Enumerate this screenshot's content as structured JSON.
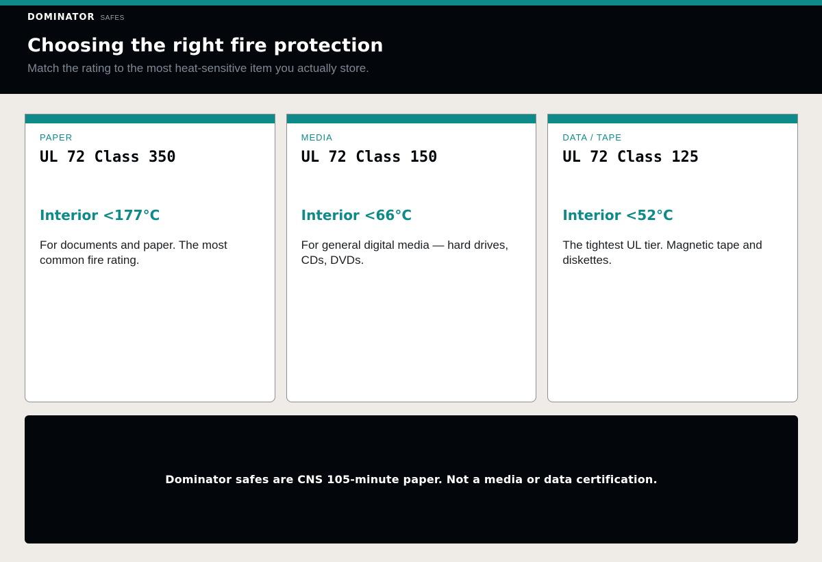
{
  "brand": {
    "name": "DOMINATOR",
    "sub": "SAFES"
  },
  "header": {
    "title": "Choosing the right fire protection",
    "subtitle": "Match the rating to the most heat-sensitive item you actually store."
  },
  "cards": [
    {
      "category": "PAPER",
      "rating": "UL 72 Class 350",
      "temp": "Interior <177°C",
      "description": "For documents and paper. The most common fire rating."
    },
    {
      "category": "MEDIA",
      "rating": "UL 72 Class 150",
      "temp": "Interior <66°C",
      "description": "For general digital media — hard drives, CDs, DVDs."
    },
    {
      "category": "DATA / TAPE",
      "rating": "UL 72 Class 125",
      "temp": "Interior <52°C",
      "description": "The tightest UL tier. Magnetic tape and diskettes."
    }
  ],
  "footer": {
    "note": "Dominator safes are CNS 105-minute paper. Not a media or data certification."
  },
  "colors": {
    "accent": "#0e8a88",
    "header_bg": "#03060b",
    "page_bg": "#efebe7",
    "card_bg": "#ffffff"
  }
}
